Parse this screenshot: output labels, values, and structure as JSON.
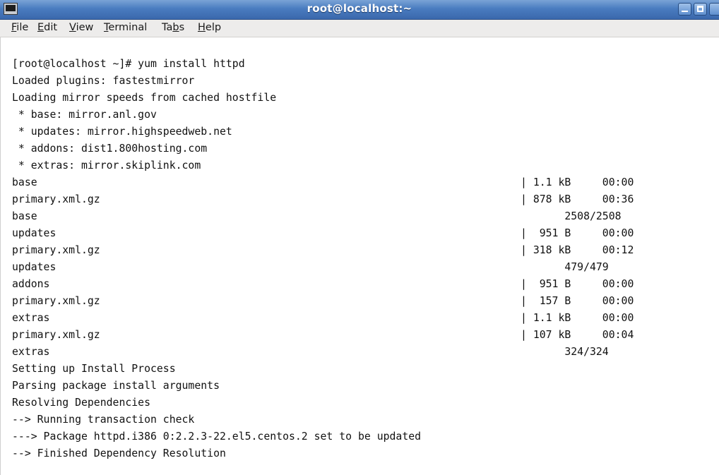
{
  "window": {
    "title": "root@localhost:~",
    "buttons": {
      "minimize": "minimize",
      "maximize": "maximize"
    }
  },
  "menubar": {
    "items": [
      {
        "pre": "",
        "acc": "F",
        "post": "ile"
      },
      {
        "pre": "",
        "acc": "E",
        "post": "dit"
      },
      {
        "pre": "",
        "acc": "V",
        "post": "iew"
      },
      {
        "pre": "",
        "acc": "T",
        "post": "erminal"
      },
      {
        "pre": "Ta",
        "acc": "b",
        "post": "s"
      },
      {
        "pre": "",
        "acc": "H",
        "post": "elp"
      }
    ]
  },
  "terminal": {
    "lines": [
      {
        "left": "[root@localhost ~]# yum install httpd",
        "right": ""
      },
      {
        "left": "Loaded plugins: fastestmirror",
        "right": ""
      },
      {
        "left": "Loading mirror speeds from cached hostfile",
        "right": ""
      },
      {
        "left": " * base: mirror.anl.gov",
        "right": ""
      },
      {
        "left": " * updates: mirror.highspeedweb.net",
        "right": ""
      },
      {
        "left": " * addons: dist1.800hosting.com",
        "right": ""
      },
      {
        "left": " * extras: mirror.skiplink.com",
        "right": ""
      },
      {
        "left": "base",
        "right": "| 1.1 kB     00:00"
      },
      {
        "left": "primary.xml.gz",
        "right": "| 878 kB     00:36"
      },
      {
        "left": "base",
        "right": "       2508/2508"
      },
      {
        "left": "updates",
        "right": "|  951 B     00:00"
      },
      {
        "left": "primary.xml.gz",
        "right": "| 318 kB     00:12"
      },
      {
        "left": "updates",
        "right": "       479/479"
      },
      {
        "left": "addons",
        "right": "|  951 B     00:00"
      },
      {
        "left": "primary.xml.gz",
        "right": "|  157 B     00:00"
      },
      {
        "left": "extras",
        "right": "| 1.1 kB     00:00"
      },
      {
        "left": "primary.xml.gz",
        "right": "| 107 kB     00:04"
      },
      {
        "left": "extras",
        "right": "       324/324"
      },
      {
        "left": "Setting up Install Process",
        "right": ""
      },
      {
        "left": "Parsing package install arguments",
        "right": ""
      },
      {
        "left": "Resolving Dependencies",
        "right": ""
      },
      {
        "left": "--> Running transaction check",
        "right": ""
      },
      {
        "left": "---> Package httpd.i386 0:2.2.3-22.el5.centos.2 set to be updated",
        "right": ""
      },
      {
        "left": "--> Finished Dependency Resolution",
        "right": ""
      }
    ]
  },
  "colors": {
    "titlebar": "#4a7cc0",
    "menubar": "#edeceb",
    "terminal_bg": "#ffffff",
    "terminal_fg": "#111111"
  }
}
